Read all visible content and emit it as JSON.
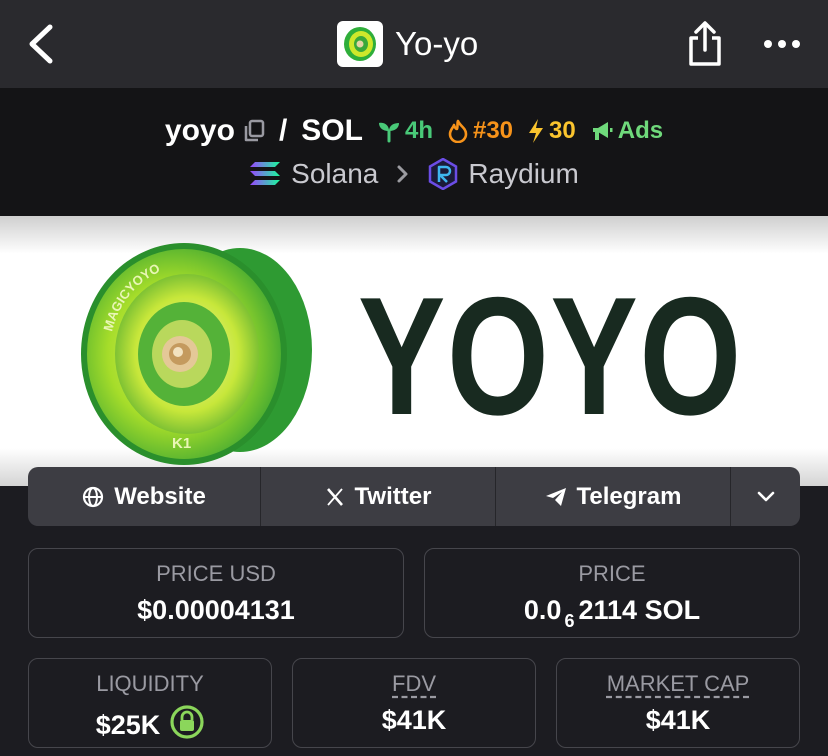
{
  "nav": {
    "title": "Yo-yo",
    "back_icon": "chevron-left-icon",
    "share_icon": "share-icon",
    "more_icon": "more-dots-icon"
  },
  "pair": {
    "token": "yoyo",
    "separator": "/",
    "quote": "SOL",
    "age": "4h",
    "trending_rank": "#30",
    "boosts": "30",
    "ads_label": "Ads"
  },
  "chain": {
    "network": "Solana",
    "dex": "Raydium"
  },
  "banner": {
    "text": "YOYO",
    "yoyo_lettering": "MAGICYOYO",
    "yoyo_model": "K1"
  },
  "links": {
    "website": "Website",
    "twitter": "Twitter",
    "telegram": "Telegram"
  },
  "stats": {
    "price_usd_label": "PRICE USD",
    "price_usd_value": "$0.00004131",
    "price_label": "PRICE",
    "price_prefix": "0.0",
    "price_zeros": "6",
    "price_digits": "2114",
    "price_unit": "SOL",
    "liquidity_label": "LIQUIDITY",
    "liquidity_value": "$25K",
    "fdv_label": "FDV",
    "fdv_value": "$41K",
    "mcap_label": "MARKET CAP",
    "mcap_value": "$41K"
  },
  "colors": {
    "background": "#1c1c21",
    "topbar": "#2a2a2e",
    "pairbar": "#141416",
    "age_green": "#49c978",
    "hot_orange": "#f7931a",
    "boost_yellow": "#fac42e",
    "ads_green": "#6fd97b",
    "lock_green": "#8bd65b"
  }
}
